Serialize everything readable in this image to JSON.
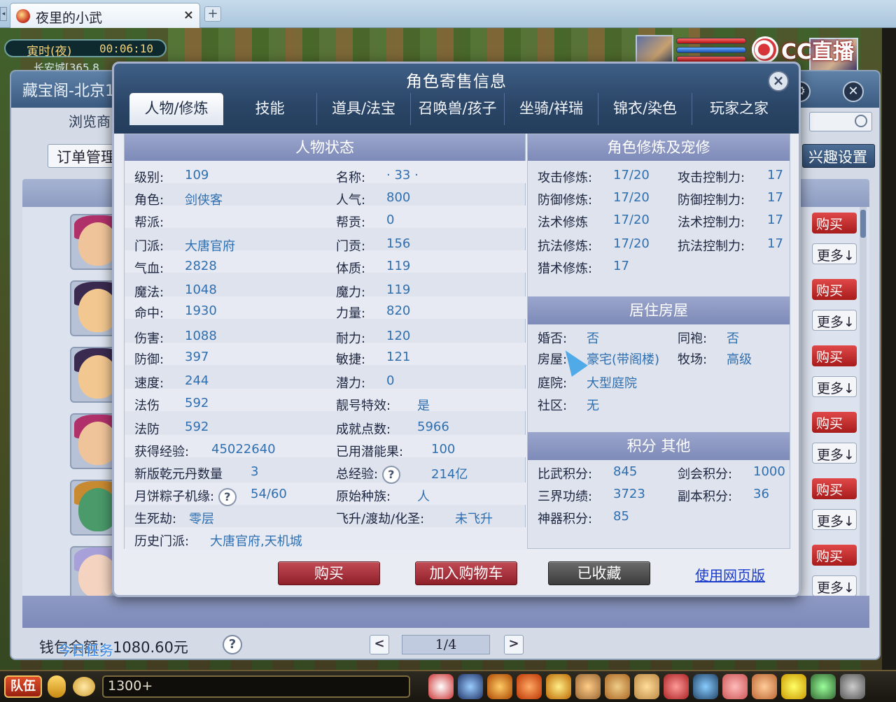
{
  "browser": {
    "tab_title": "夜里的小武",
    "tab_close": "×",
    "new_tab": "+"
  },
  "hud": {
    "time_period": "寅时(夜)",
    "time_clock": "00:06:10",
    "location": "长安城[365,8",
    "cc_brand": "CC直播"
  },
  "backwin": {
    "title": "藏宝阁-北京1",
    "subtitle": "浏览商",
    "order_button": "订单管理",
    "interest_button": "兴趣设置",
    "buy_label": "购买",
    "more_label": "更多↓",
    "wallet": "钱包余额：1080.60元",
    "page_indicator": "1/4",
    "prev": "<",
    "next": ">",
    "help": "?",
    "task_tip": "今日任务"
  },
  "modal": {
    "title": "角色寄售信息",
    "close": "×",
    "tabs": [
      "人物/修炼",
      "技能",
      "道具/法宝",
      "召唤兽/孩子",
      "坐骑/祥瑞",
      "锦衣/染色",
      "玩家之家"
    ],
    "left_panel_title": "人物状态",
    "right_panel_title": "角色修炼及宠修",
    "house_title": "居住房屋",
    "score_title": "积分 其他",
    "status_col1": [
      {
        "label": "级别:",
        "value": "109"
      },
      {
        "label": "角色:",
        "value": "剑侠客"
      },
      {
        "label": "帮派:",
        "value": ""
      },
      {
        "label": "门派:",
        "value": "大唐官府"
      },
      {
        "label": "气血:",
        "value": "2828"
      },
      {
        "label": "魔法:",
        "value": "1048"
      },
      {
        "label": "命中:",
        "value": "1930"
      },
      {
        "label": "伤害:",
        "value": "1088"
      },
      {
        "label": "防御:",
        "value": "397"
      },
      {
        "label": "速度:",
        "value": "244"
      },
      {
        "label": "法伤",
        "value": "592"
      },
      {
        "label": "法防",
        "value": "592"
      }
    ],
    "status_col2": [
      {
        "label": "名称:",
        "value": "· 33 ·"
      },
      {
        "label": "人气:",
        "value": "800"
      },
      {
        "label": "帮贡:",
        "value": "0"
      },
      {
        "label": "门贡:",
        "value": "156"
      },
      {
        "label": "体质:",
        "value": "119"
      },
      {
        "label": "魔力:",
        "value": "119"
      },
      {
        "label": "力量:",
        "value": "820"
      },
      {
        "label": "耐力:",
        "value": "120"
      },
      {
        "label": "敏捷:",
        "value": "121"
      },
      {
        "label": "潜力:",
        "value": "0"
      },
      {
        "label": "靓号特效:",
        "value": "是"
      },
      {
        "label": "成就点数:",
        "value": "5966"
      }
    ],
    "exp_label": "获得经验:",
    "exp_value": "45022640",
    "qianyuan_label": "新版乾元丹数量",
    "qianyuan_value": "3",
    "mooncake_label": "月饼粽子机缘:",
    "mooncake_value": "54/60",
    "shengsi_label": "生死劫:",
    "shengsi_value": "零层",
    "history_label": "历史门派:",
    "history_value": "大唐官府,天机城",
    "used_fruit_label": "已用潜能果:",
    "used_fruit_value": "100",
    "total_exp_label": "总经验:",
    "total_exp_value": "214亿",
    "race_label": "原始种族:",
    "race_value": "人",
    "ascend_label": "飞升/渡劫/化圣:",
    "ascend_value": "未飞升",
    "cultivation": [
      {
        "label": "攻击修炼:",
        "value": "17/20",
        "label2": "攻击控制力:",
        "value2": "17"
      },
      {
        "label": "防御修炼:",
        "value": "17/20",
        "label2": "防御控制力:",
        "value2": "17"
      },
      {
        "label": "法术修炼",
        "value": "17/20",
        "label2": "法术控制力:",
        "value2": "17"
      },
      {
        "label": "抗法修炼:",
        "value": "17/20",
        "label2": "抗法控制力:",
        "value2": "17"
      },
      {
        "label": "猎术修炼:",
        "value": "17",
        "label2": "",
        "value2": ""
      }
    ],
    "house": [
      {
        "label": "婚否:",
        "value": "否",
        "label2": "同袍:",
        "value2": "否"
      },
      {
        "label": "房屋:",
        "value": "豪宅(带阁楼)",
        "label2": "牧场:",
        "value2": "高级"
      },
      {
        "label": "庭院:",
        "value": "大型庭院",
        "label2": "",
        "value2": ""
      },
      {
        "label": "社区:",
        "value": "无",
        "label2": "",
        "value2": ""
      }
    ],
    "scores": [
      {
        "label": "比武积分:",
        "value": "845",
        "label2": "剑会积分:",
        "value2": "1000"
      },
      {
        "label": "三界功绩:",
        "value": "3723",
        "label2": "副本积分:",
        "value2": "36"
      },
      {
        "label": "神器积分:",
        "value": "85",
        "label2": "",
        "value2": ""
      }
    ],
    "buttons": {
      "buy": "购买",
      "cart": "加入购物车",
      "favorited": "已收藏",
      "web_version": "使用网页版"
    },
    "help": "?"
  },
  "gamebar": {
    "team": "队伍",
    "chat_value": "1300+"
  }
}
